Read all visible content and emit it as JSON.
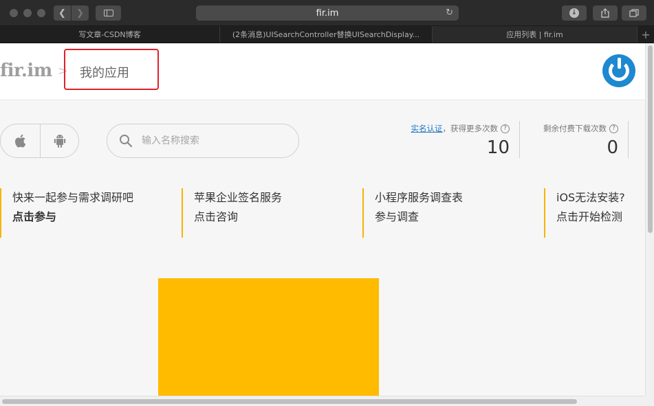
{
  "browser": {
    "url": "fir.im",
    "tabs": [
      {
        "title": "写文章-CSDN博客"
      },
      {
        "title": "(2条消息)UISearchController替换UISearchDisplay..."
      },
      {
        "title": "应用列表 | fir.im"
      }
    ],
    "new_tab_label": "+"
  },
  "header": {
    "logo": "fir.im",
    "separator": ">",
    "page_title": "我的应用"
  },
  "platform": {
    "ios_icon": "apple-icon",
    "android_icon": "android-icon"
  },
  "search": {
    "placeholder": "输入名称搜索"
  },
  "stats": [
    {
      "link": "实名认证",
      "label": "，获得更多次数",
      "value": "10"
    },
    {
      "label": "剩余付费下载次数",
      "value": "0"
    }
  ],
  "promos": [
    {
      "title": "快来一起参与需求调研吧",
      "action": "点击参与"
    },
    {
      "title": "苹果企业签名服务",
      "action": "点击咨询"
    },
    {
      "title": "小程序服务调查表",
      "action": "参与调查"
    },
    {
      "title": "iOS无法安装?",
      "action": "点击开始检测"
    }
  ],
  "colors": {
    "accent_yellow": "#ffbb00",
    "avatar_blue": "#1e88d0",
    "highlight_red": "#e0202a",
    "link_blue": "#1e78c8"
  }
}
